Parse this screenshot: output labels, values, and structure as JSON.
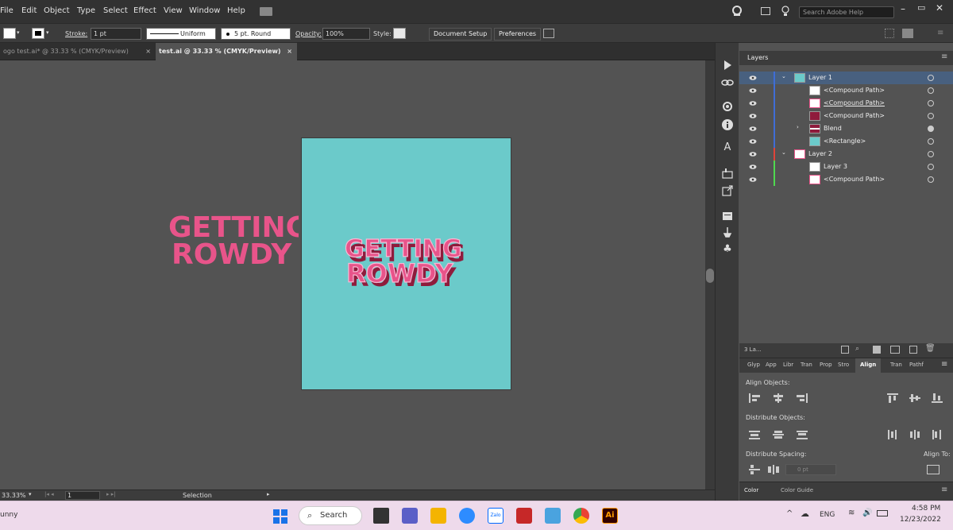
{
  "menu": {
    "items": [
      "File",
      "Edit",
      "Object",
      "Type",
      "Select",
      "Effect",
      "View",
      "Window",
      "Help"
    ],
    "search_placeholder": "Search Adobe Help"
  },
  "control": {
    "stroke_label": "Stroke:",
    "stroke_value": "1 pt",
    "profile": "Uniform",
    "brush": "5 pt. Round",
    "opacity_label": "Opacity:",
    "opacity_value": "100%",
    "style_label": "Style:",
    "document_setup": "Document Setup",
    "preferences": "Preferences"
  },
  "tabs": [
    {
      "label": "ogo test.ai* @ 33.33 % (CMYK/Preview)"
    },
    {
      "label": "test.ai @ 33.33 % (CMYK/Preview)"
    }
  ],
  "artwork": {
    "line1": "GETTING",
    "line2": "ROWDY",
    "pink": "#e8548a",
    "dark": "#8f1b3c",
    "light": "#f7b8d3"
  },
  "artboard_color": "#6bcaca",
  "layers": {
    "title": "Layers",
    "rows": [
      {
        "name": "Layer 1",
        "bar": "#3f6dd6"
      },
      {
        "name": "<Compound Path>",
        "bar": "#3f6dd6"
      },
      {
        "name": "<Compound Path>",
        "bar": "#3f6dd6"
      },
      {
        "name": "<Compound Path>",
        "bar": "#3f6dd6"
      },
      {
        "name": "Blend",
        "bar": "#3f6dd6"
      },
      {
        "name": "<Rectangle>",
        "bar": "#3f6dd6"
      },
      {
        "name": "Layer 2",
        "bar": "#e0443a"
      },
      {
        "name": "Layer 3",
        "bar": "#4fd94f"
      },
      {
        "name": "<Compound Path>",
        "bar": "#4fd94f"
      }
    ],
    "footer_count": "3 La..."
  },
  "align": {
    "tabs": [
      "Glyp",
      "App",
      "Libr",
      "Tran",
      "Prop",
      "Stro",
      "Align",
      "Tran",
      "Pathf"
    ],
    "align_objects": "Align Objects:",
    "distribute_objects": "Distribute Objects:",
    "distribute_spacing": "Distribute Spacing:",
    "align_to": "Align To:",
    "spacing_value": "0 pt"
  },
  "color_panel": {
    "tabs": [
      "Color",
      "Color Guide"
    ]
  },
  "status": {
    "zoom": "33.33%",
    "page": "1",
    "tool": "Selection"
  },
  "taskbar": {
    "left_text": "unny",
    "search": "Search",
    "lang": "ENG",
    "time": "4:58 PM",
    "date": "12/23/2022"
  }
}
